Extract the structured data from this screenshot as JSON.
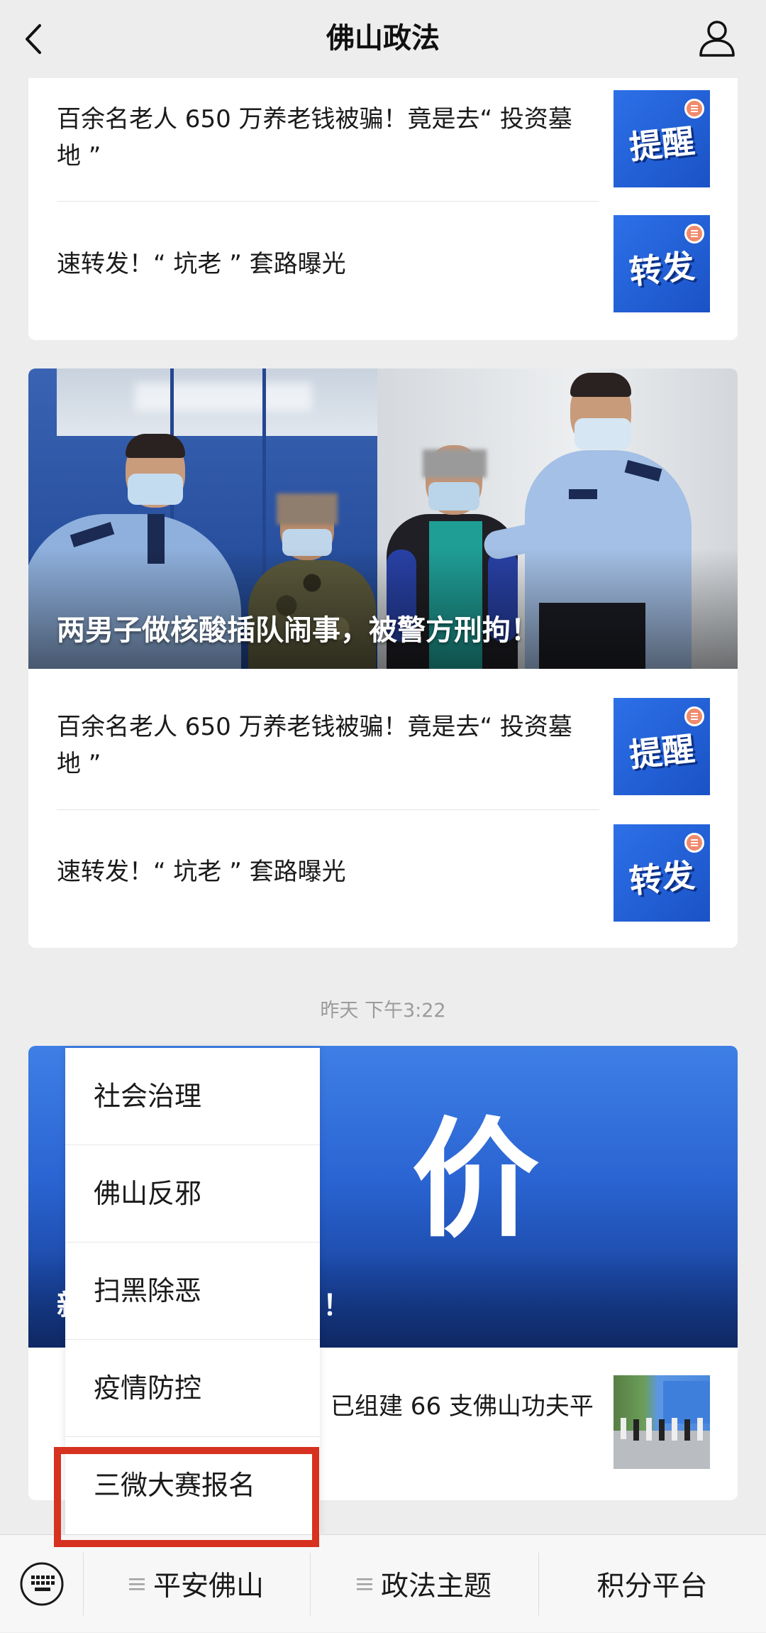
{
  "header": {
    "title": "佛山政法",
    "back_icon": "chevron-left-icon",
    "profile_icon": "person-icon"
  },
  "feed": {
    "card1": {
      "articles": [
        {
          "title_lines": [
            "百余名老人 650 万养老钱被骗！竟是去“ 投资墓",
            "地 ”"
          ],
          "thumb_label": "提醒"
        },
        {
          "title_lines": [
            "速转发！“ 坑老 ” 套路曝光"
          ],
          "thumb_label": "转发"
        }
      ]
    },
    "card2": {
      "hero_caption": "两男子做核酸插队闹事，被警方刑拘！",
      "articles": [
        {
          "title_lines": [
            "百余名老人 650 万养老钱被骗！竟是去“ 投资墓",
            "地 ”"
          ],
          "thumb_label": "提醒"
        },
        {
          "title_lines": [
            "速转发！“ 坑老 ” 套路曝光"
          ],
          "thumb_label": "转发"
        }
      ]
    },
    "timestamp": "昨天 下午3:22",
    "card3": {
      "hero_big_text": "价",
      "hero_caption_start": "新",
      "hero_caption_end": "！",
      "article_visible_text": "已组建 66 支佛山功夫平"
    }
  },
  "popup_menu": {
    "items": [
      "社会治理",
      "佛山反邪",
      "扫黑除恶",
      "疫情防控",
      "三微大赛报名"
    ]
  },
  "bottom_bar": {
    "keyboard_icon": "keyboard-icon",
    "tabs": [
      {
        "label": "平安佛山",
        "icon": "submenu-icon"
      },
      {
        "label": "政法主题",
        "icon": "submenu-icon"
      },
      {
        "label": "积分平台"
      }
    ]
  },
  "colors": {
    "background": "#ededed",
    "card": "#ffffff",
    "text": "#1a1a1a",
    "timestamp": "#9b9b9b",
    "thumb_blue": "#1f5cd6",
    "highlight": "#d6321f"
  }
}
